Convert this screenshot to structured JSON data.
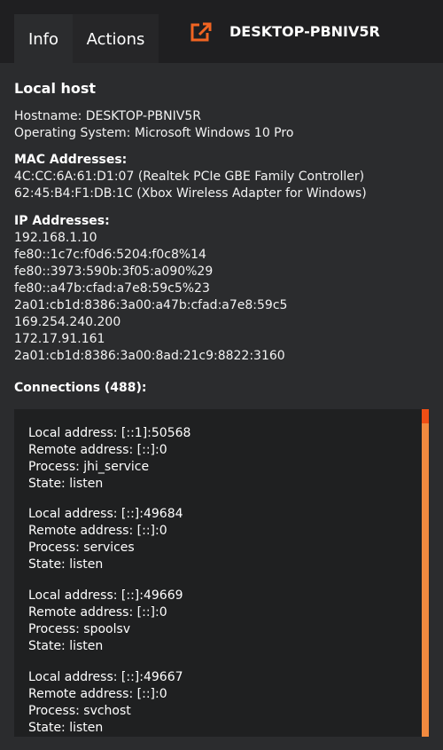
{
  "tabs": {
    "info": "Info",
    "actions": "Actions"
  },
  "header": {
    "host_name": "DESKTOP-PBNIV5R",
    "icon": "external-link-icon",
    "accent": "#f26522"
  },
  "local": {
    "title": "Local host",
    "hostname": "Hostname: DESKTOP-PBNIV5R",
    "os": "Operating System: Microsoft Windows 10 Pro",
    "mac_title": "MAC Addresses:",
    "macs": [
      "4C:CC:6A:61:D1:07 (Realtek PCIe GBE Family Controller)",
      "62:45:B4:F1:DB:1C (Xbox Wireless Adapter for Windows)"
    ],
    "ip_title": "IP Addresses:",
    "ips": [
      "192.168.1.10",
      "fe80::1c7c:f0d6:5204:f0c8%14",
      "fe80::3973:590b:3f05:a090%29",
      "fe80::a47b:cfad:a7e8:59c5%23",
      "2a01:cb1d:8386:3a00:a47b:cfad:a7e8:59c5",
      "169.254.240.200",
      "172.17.91.161",
      "2a01:cb1d:8386:3a00:8ad:21c9:8822:3160"
    ],
    "connections_title": "Connections (488):"
  },
  "connections": [
    {
      "local": "Local address: [::1]:50568",
      "remote": "Remote address: [::]:0",
      "process": "Process: jhi_service",
      "state": "State: listen"
    },
    {
      "local": "Local address: [::]:49684",
      "remote": "Remote address: [::]:0",
      "process": "Process: services",
      "state": "State: listen"
    },
    {
      "local": "Local address: [::]:49669",
      "remote": "Remote address: [::]:0",
      "process": "Process: spoolsv",
      "state": "State: listen"
    },
    {
      "local": "Local address: [::]:49667",
      "remote": "Remote address: [::]:0",
      "process": "Process: svchost",
      "state": "State: listen"
    }
  ],
  "colors": {
    "background": "#2b2c2e",
    "topbar": "#1f1f21",
    "scrollbar": "#f28a3f",
    "scroll_thumb": "#f04e14"
  }
}
